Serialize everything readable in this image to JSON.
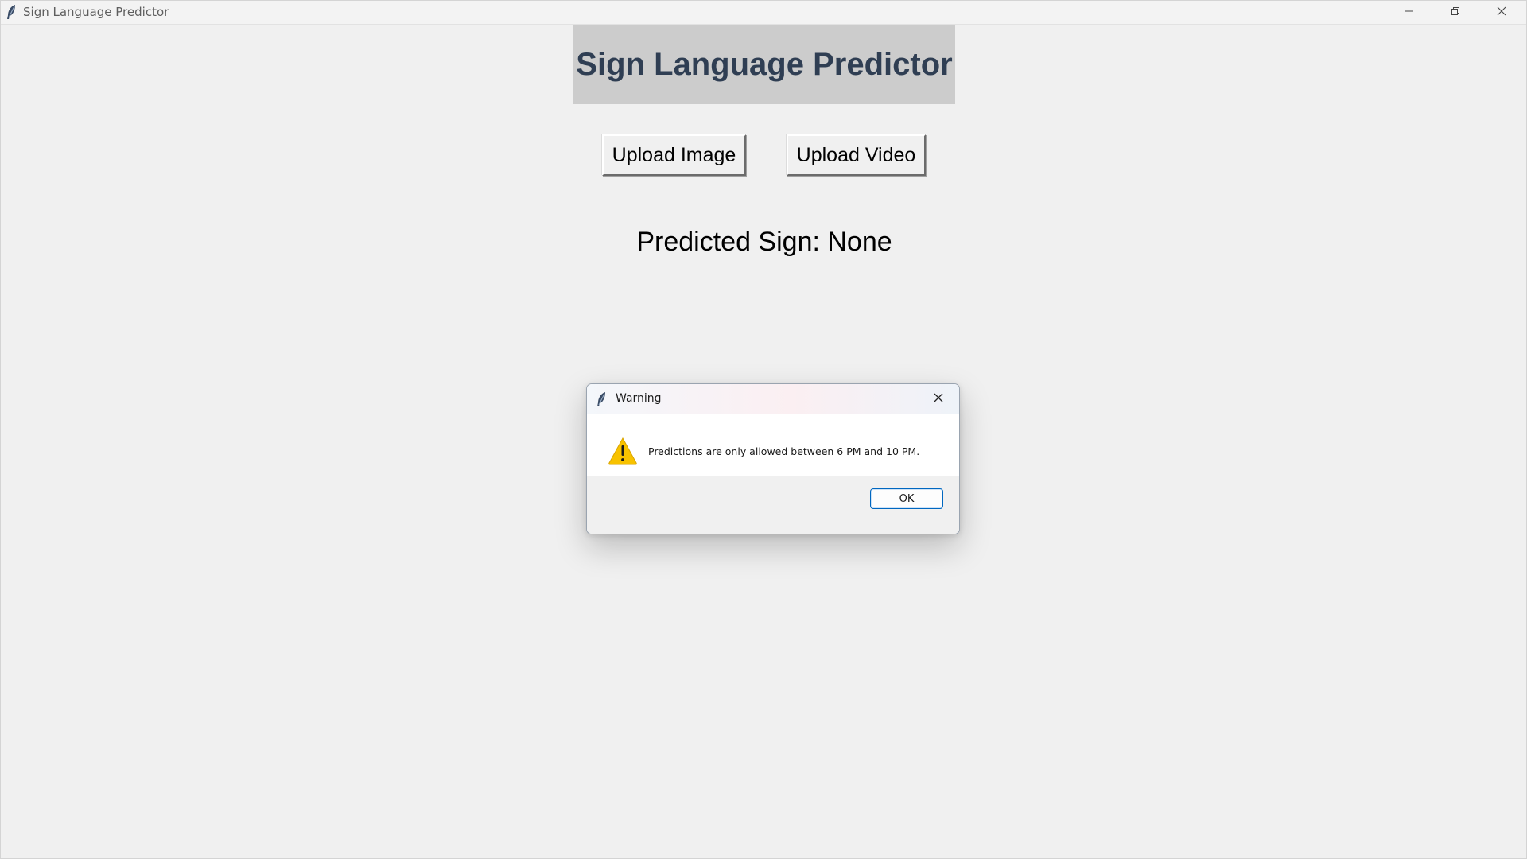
{
  "window": {
    "title": "Sign Language Predictor",
    "controls": {
      "minimize": "minimize-icon",
      "maximize": "restore-icon",
      "close": "close-icon"
    }
  },
  "main": {
    "heading": "Sign Language Predictor",
    "upload_image_label": "Upload Image",
    "upload_video_label": "Upload Video",
    "prediction_text": "Predicted Sign: None"
  },
  "dialog": {
    "title": "Warning",
    "message": "Predictions are only allowed between 6 PM and 10 PM.",
    "ok_label": "OK",
    "icon": "warning-icon"
  },
  "colors": {
    "heading_text": "#2f3e53",
    "heading_bg": "#cccccc",
    "window_bg": "#f0f0f0",
    "ok_border": "#0067c0",
    "warning_yellow": "#f8c200"
  }
}
